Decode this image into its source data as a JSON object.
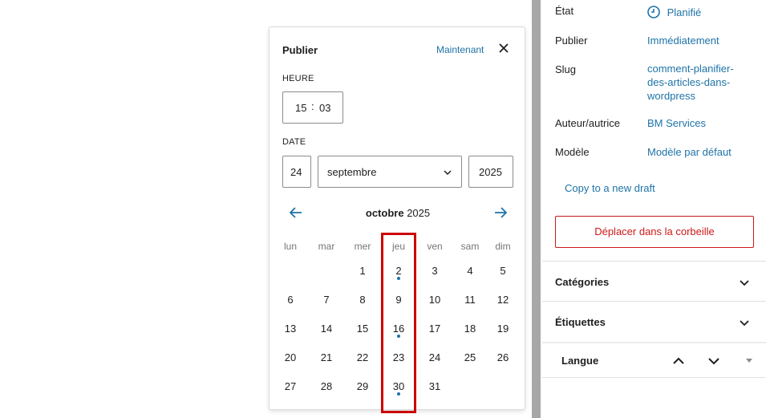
{
  "popover": {
    "title": "Publier",
    "now_link": "Maintenant",
    "time_label": "HEURE",
    "hour": "15",
    "time_sep": ":",
    "minute": "03",
    "date_label": "DATE",
    "day": "24",
    "month": "septembre",
    "year": "2025",
    "calendar": {
      "month_name": "octobre",
      "year": "2025",
      "weekdays": [
        "lun",
        "mar",
        "mer",
        "jeu",
        "ven",
        "sam",
        "dim"
      ],
      "weeks": [
        [
          "",
          "",
          "1",
          "2",
          "3",
          "4",
          "5"
        ],
        [
          "6",
          "7",
          "8",
          "9",
          "10",
          "11",
          "12"
        ],
        [
          "13",
          "14",
          "15",
          "16",
          "17",
          "18",
          "19"
        ],
        [
          "20",
          "21",
          "22",
          "23",
          "24",
          "25",
          "26"
        ],
        [
          "27",
          "28",
          "29",
          "30",
          "31",
          "",
          ""
        ]
      ],
      "days_with_posts": [
        "2",
        "16",
        "30"
      ]
    },
    "icons": {
      "close": "close-icon",
      "prev": "arrow-left-icon",
      "next": "arrow-right-icon"
    }
  },
  "sidebar": {
    "rows": [
      {
        "label": "État",
        "value": "Planifié",
        "icon": "clock-icon"
      },
      {
        "label": "Publier",
        "value": "Immédiatement"
      },
      {
        "label": "Slug",
        "value": "comment-planifier-des-articles-dans-wordpress"
      },
      {
        "label": "Auteur/autrice",
        "value": "BM Services"
      },
      {
        "label": "Modèle",
        "value": "Modèle par défaut"
      }
    ],
    "copy_draft": "Copy to a new draft",
    "trash": "Déplacer dans la corbeille",
    "panels": [
      {
        "title": "Catégories"
      },
      {
        "title": "Étiquettes"
      },
      {
        "title": "Langue"
      }
    ]
  },
  "colors": {
    "accent": "#1e73a8",
    "danger": "#cc1818",
    "highlight": "#cc0000"
  }
}
